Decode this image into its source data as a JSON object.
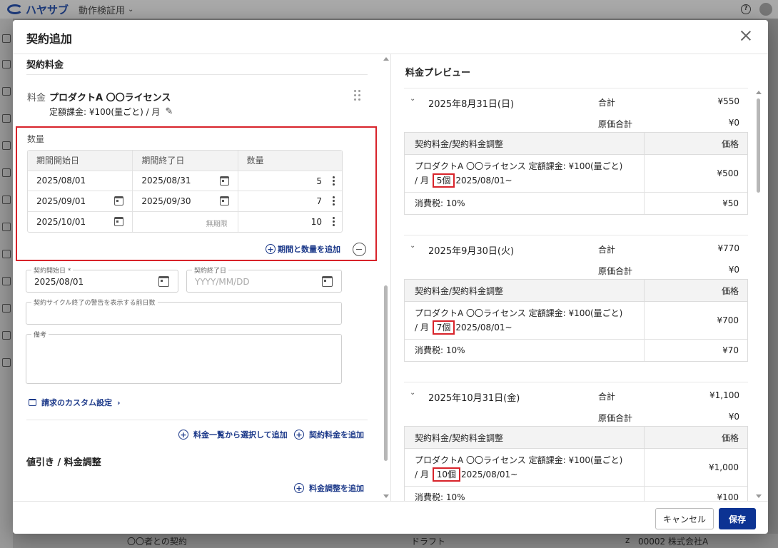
{
  "app": {
    "logo_text": "ハヤサブ",
    "environment": "動作検証用",
    "background_row": {
      "name": "〇〇者との契約",
      "status": "ドラフト",
      "code": "z",
      "company": "00002 株式会社A"
    }
  },
  "modal": {
    "title": "契約追加",
    "left": {
      "section_fee": "契約料金",
      "fee_label": "料金",
      "fee_name": "プロダクトA 〇〇ライセンス",
      "fee_description": "定額課金: ¥100(量ごと) / 月",
      "quantity": {
        "label": "数量",
        "headers": [
          "期間開始日",
          "期間終了日",
          "数量"
        ],
        "rows": [
          {
            "start": "2025/08/01",
            "end": "2025/08/31",
            "qty": "5"
          },
          {
            "start": "2025/09/01",
            "end": "2025/09/30",
            "qty": "7"
          },
          {
            "start": "2025/10/01",
            "end": "無期限",
            "qty": "10"
          }
        ],
        "add_label": "期間と数量を追加"
      },
      "contract_start": {
        "label": "契約開始日 *",
        "value": "2025/08/01"
      },
      "contract_end": {
        "label": "契約終了日",
        "placeholder": "YYYY/MM/DD"
      },
      "warning_days": {
        "label": "契約サイクル終了の警告を表示する前日数"
      },
      "notes": {
        "label": "備考"
      },
      "billing_custom": "請求のカスタム設定",
      "add_from_list": "料金一覧から選択して追加",
      "add_fee": "契約料金を追加",
      "section_discount": "値引き / 料金調整",
      "add_adjustment": "料金調整を追加"
    },
    "right": {
      "title": "料金プレビュー",
      "total_label": "合計",
      "cost_label": "原価合計",
      "table_headers": [
        "契約料金/契約料金調整",
        "価格"
      ],
      "item_prefix": "プロダクトA 〇〇ライセンス 定額課金: ¥100(量ごと)",
      "item_mid": "/ 月",
      "item_suffix": "2025/08/01~",
      "tax_label": "消費税: 10%",
      "months": [
        {
          "date": "2025年8月31日(日)",
          "total": "¥550",
          "cost": "¥0",
          "qty": "5個",
          "price": "¥500",
          "tax": "¥50"
        },
        {
          "date": "2025年9月30日(火)",
          "total": "¥770",
          "cost": "¥0",
          "qty": "7個",
          "price": "¥700",
          "tax": "¥70"
        },
        {
          "date": "2025年10月31日(金)",
          "total": "¥1,100",
          "cost": "¥0",
          "qty": "10個",
          "price": "¥1,000",
          "tax": "¥100"
        }
      ]
    },
    "footer": {
      "cancel": "キャンセル",
      "save": "保存"
    }
  }
}
